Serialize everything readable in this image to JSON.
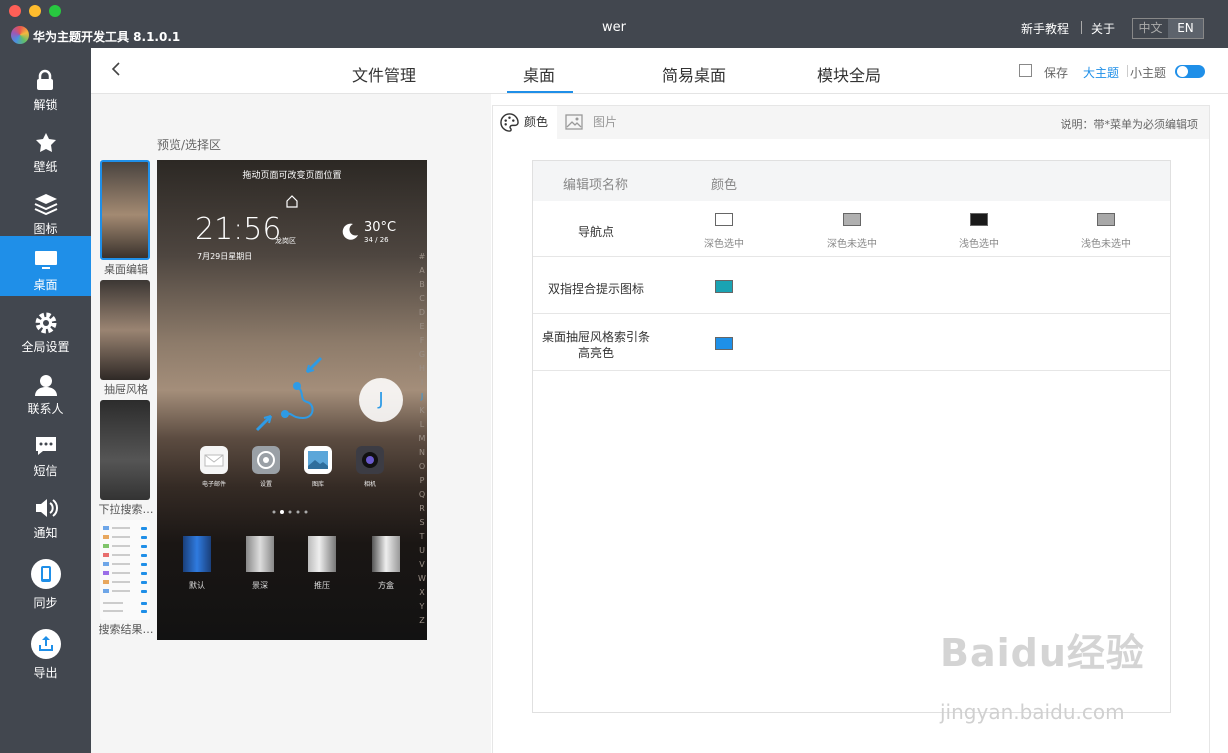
{
  "app": {
    "name": "华为主题开发工具 8.1.0.1",
    "window_title": "wer"
  },
  "topbar": {
    "tutorial": "新手教程",
    "about": "关于",
    "lang_cn": "中文",
    "lang_en": "EN"
  },
  "sidebar": {
    "items": [
      {
        "label": "解锁",
        "icon": "lock-icon"
      },
      {
        "label": "壁纸",
        "icon": "wallpaper-icon"
      },
      {
        "label": "图标",
        "icon": "layers-icon"
      },
      {
        "label": "桌面",
        "icon": "monitor-icon",
        "active": true
      },
      {
        "label": "全局设置",
        "icon": "gear-icon"
      },
      {
        "label": "联系人",
        "icon": "person-icon"
      },
      {
        "label": "短信",
        "icon": "chat-icon"
      },
      {
        "label": "通知",
        "icon": "speaker-icon"
      },
      {
        "label": "同步",
        "icon": "phone-icon"
      },
      {
        "label": "导出",
        "icon": "upload-icon"
      }
    ]
  },
  "nav": {
    "tabs": [
      "文件管理",
      "桌面",
      "简易桌面",
      "模块全局"
    ],
    "active_tab": "桌面",
    "save": "保存",
    "big_theme": "大主题",
    "small_theme": "小主题"
  },
  "preview": {
    "label": "预览/选择区",
    "thumbnails": [
      "桌面编辑",
      "抽屉风格",
      "下拉搜索…",
      "搜索结果…"
    ],
    "phone": {
      "hint": "拖动页面可改变页面位置",
      "time": "21:56",
      "location": "龙岗区",
      "date": "7月29日星期日",
      "temp": "30°C",
      "temp_range": "34 / 26",
      "apps": [
        "电子邮件",
        "设置",
        "图库",
        "相机"
      ],
      "transitions": [
        "默认",
        "景深",
        "推压",
        "方盒"
      ],
      "letter_badge": "J",
      "alphabet": [
        "#",
        "A",
        "B",
        "C",
        "D",
        "E",
        "F",
        "G",
        "H",
        "I",
        "J",
        "K",
        "L",
        "M",
        "N",
        "O",
        "P",
        "Q",
        "R",
        "S",
        "T",
        "U",
        "V",
        "W",
        "X",
        "Y",
        "Z"
      ]
    }
  },
  "editor": {
    "tabs": [
      "颜色",
      "图片"
    ],
    "note": "说明：带*菜单为必须编辑项",
    "columns": [
      "编辑项名称",
      "颜色"
    ],
    "rows": [
      {
        "name": "导航点",
        "swatches": [
          {
            "label": "深色选中",
            "color": "#ffffff"
          },
          {
            "label": "深色未选中",
            "color": "#b0b0b0"
          },
          {
            "label": "浅色选中",
            "color": "#1a1a1a"
          },
          {
            "label": "浅色未选中",
            "color": "#a8a8a8"
          }
        ]
      },
      {
        "name": "双指捏合提示图标",
        "swatches": [
          {
            "label": "",
            "color": "#1aa3b3"
          }
        ]
      },
      {
        "name": "桌面抽屉风格索引条高亮色",
        "swatches": [
          {
            "label": "",
            "color": "#1e90e8"
          }
        ]
      }
    ]
  },
  "watermark": {
    "brand": "Baidu经验",
    "url": "jingyan.baidu.com"
  }
}
